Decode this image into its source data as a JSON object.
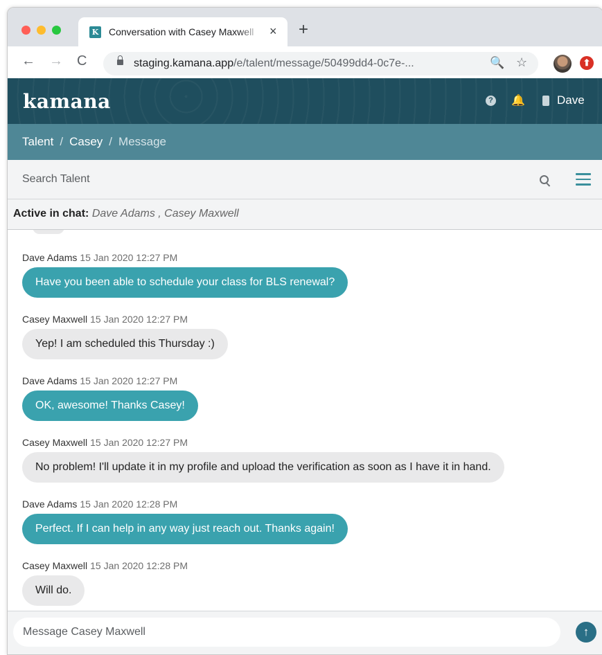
{
  "browser": {
    "tab_title": "Conversation with Casey Maxwell",
    "tab_favicon_letter": "K",
    "close_glyph": "×",
    "new_tab_glyph": "+",
    "back_glyph": "←",
    "forward_glyph": "→",
    "reload_glyph": "C",
    "url_host": "staging.kamana.app",
    "url_path": "/e/talent/message/50499dd4-0c7e-...",
    "zoom_glyph": "🔍",
    "star_glyph": "☆",
    "extension_glyph": "⬆",
    "icons": [
      "lock-icon",
      "zoom-icon",
      "star-icon",
      "avatar",
      "extension-icon"
    ]
  },
  "header": {
    "logo": "kamana",
    "help_glyph": "?",
    "bell_glyph": "🔔",
    "user_name": "Dave",
    "color": "#1f4e5e"
  },
  "breadcrumb": {
    "items": [
      "Talent",
      "Casey",
      "Message"
    ],
    "separator": "/"
  },
  "search": {
    "placeholder": "Search Talent"
  },
  "active_chat": {
    "label": "Active in chat:",
    "names": "Dave Adams , Casey Maxwell"
  },
  "messages": [
    {
      "author": "Dave Adams",
      "time": "15 Jan 2020 12:27 PM",
      "text": "Have you been able to schedule your class for BLS renewal?",
      "type": "sent"
    },
    {
      "author": "Casey Maxwell",
      "time": "15 Jan 2020 12:27 PM",
      "text": "Yep! I am scheduled this Thursday :)",
      "type": "received"
    },
    {
      "author": "Dave Adams",
      "time": "15 Jan 2020 12:27 PM",
      "text": "OK, awesome! Thanks Casey!",
      "type": "sent"
    },
    {
      "author": "Casey Maxwell",
      "time": "15 Jan 2020 12:27 PM",
      "text": "No problem! I'll update it in my profile and upload the verification as soon as I have it in hand.",
      "type": "received"
    },
    {
      "author": "Dave Adams",
      "time": "15 Jan 2020 12:28 PM",
      "text": "Perfect. If I can help in any way just reach out. Thanks again!",
      "type": "sent"
    },
    {
      "author": "Casey Maxwell",
      "time": "15 Jan 2020 12:28 PM",
      "text": "Will do.",
      "type": "received"
    }
  ],
  "compose": {
    "placeholder": "Message Casey Maxwell",
    "send_glyph": "↑"
  },
  "colors": {
    "sent_bubble": "#3aa2ae",
    "received_bubble": "#e9e9ea",
    "breadcrumb_bar": "#4f8796",
    "send_button": "#2a6f86"
  }
}
